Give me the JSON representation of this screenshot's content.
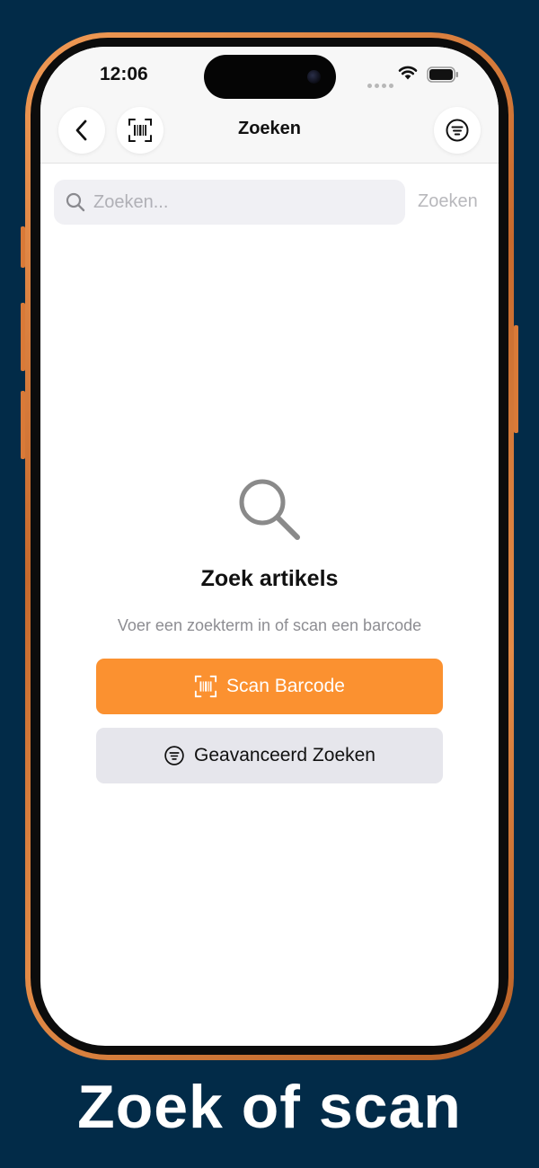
{
  "status_bar": {
    "time": "12:06",
    "icons": [
      "signal-dots-icon",
      "wifi-icon",
      "battery-icon"
    ]
  },
  "nav": {
    "title": "Zoeken",
    "back_icon": "chevron-left-icon",
    "barcode_icon": "barcode-scan-icon",
    "filter_icon": "filter-lines-icon"
  },
  "search": {
    "placeholder": "Zoeken...",
    "value": "",
    "action_label": "Zoeken",
    "icon": "search-icon"
  },
  "empty_state": {
    "icon": "magnifier-icon",
    "title": "Zoek artikels",
    "subtitle": "Voer een zoekterm in of scan een barcode"
  },
  "buttons": {
    "scan_label": "Scan Barcode",
    "scan_icon": "barcode-scan-icon",
    "advanced_label": "Geavanceerd Zoeken",
    "advanced_icon": "filter-lines-icon"
  },
  "caption": "Zoek of scan",
  "colors": {
    "background": "#022b48",
    "accent": "#fb9130",
    "frame": "#e38b47",
    "secondary_button": "#e6e6ec"
  }
}
